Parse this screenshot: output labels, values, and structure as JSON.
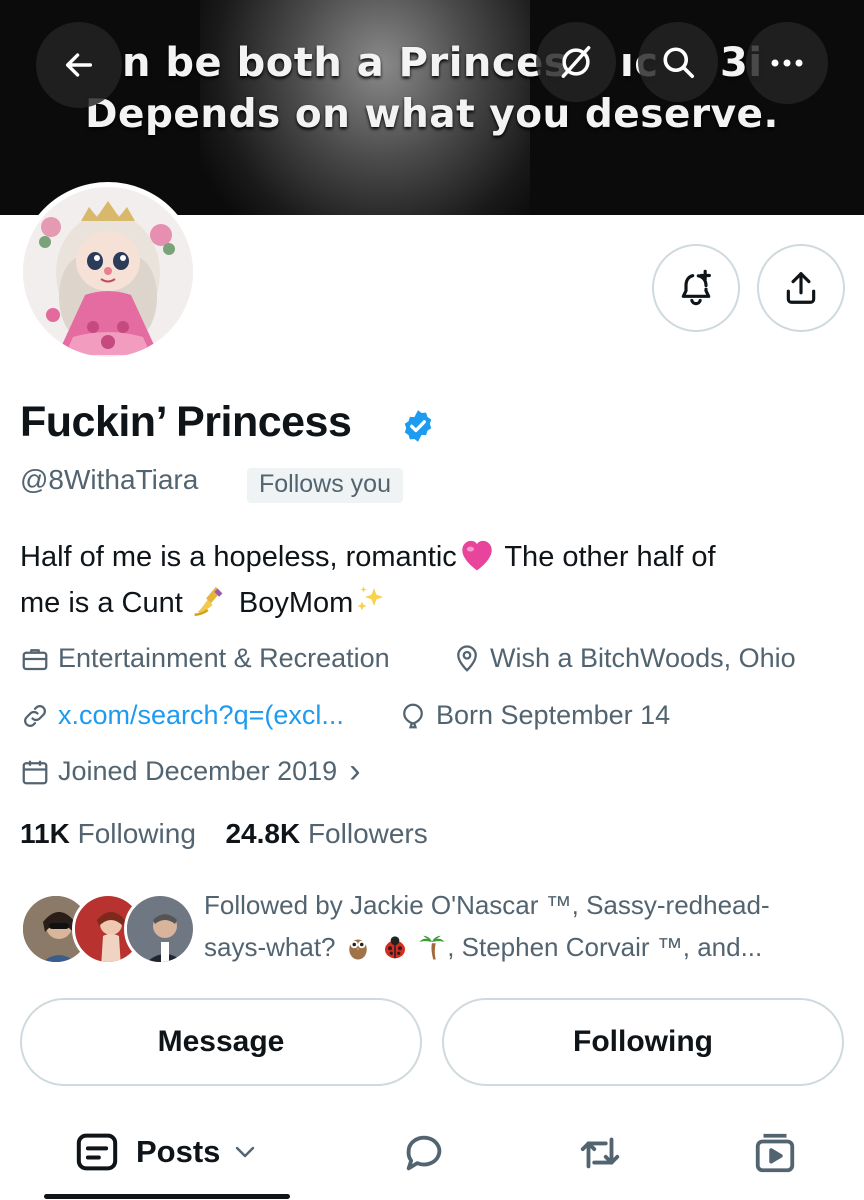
{
  "banner": {
    "line1": "n be both a Princes",
    "line1_tail": "ıc",
    "line1_end": "3i",
    "line2": "Depends on what you deserve."
  },
  "nav": {
    "back_icon": "arrow-left-icon",
    "nosync_icon": "slash-circle-icon",
    "search_icon": "search-icon",
    "more_icon": "more-dots-icon"
  },
  "profile": {
    "display_name": "Fuckin’ Princess",
    "handle": "@8WithaTiara",
    "follows_you": "Follows you",
    "bio_line1": "Half of me is a hopeless, romantic",
    "bio_line1b": " The other half of",
    "bio_line2a": "me is a Cunt ",
    "bio_line2b": " BoyMom",
    "category": "Entertainment & Recreation",
    "location": "Wish a BitchWoods, Ohio",
    "link": "x.com/search?q=(excl...",
    "birthday": "Born September 14",
    "joined": "Joined December 2019",
    "joined_chevron": "›",
    "following_count": "11K",
    "following_label": "Following",
    "followers_count": "24.8K",
    "followers_label": "Followers",
    "followed_by_a": "Followed by Jackie O'Nascar ™, Sassy-redhead-",
    "followed_by_b": "says-what? ",
    "followed_by_c": ", Stephen Corvair ™, and..."
  },
  "actions": {
    "message": "Message",
    "following": "Following"
  },
  "tabs": {
    "posts": "Posts"
  },
  "colors": {
    "verified": "#1d9bf0",
    "link": "#1d9bf0",
    "secondary_text": "#536471",
    "border": "#cfd9de"
  }
}
